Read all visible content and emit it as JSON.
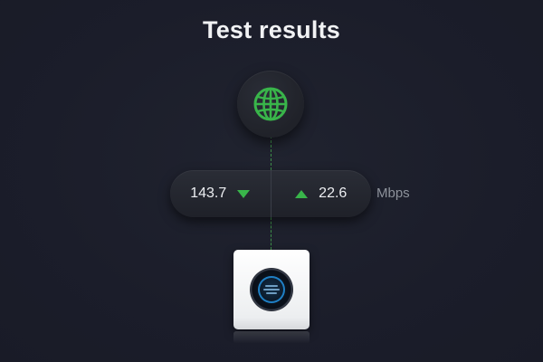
{
  "header": {
    "title": "Test results"
  },
  "speed_test": {
    "download": {
      "value": "143.7",
      "icon": "arrow-down-icon"
    },
    "upload": {
      "value": "22.6",
      "icon": "arrow-up-icon"
    },
    "unit": "Mbps"
  },
  "internet_node": {
    "icon": "globe-icon"
  },
  "device": {
    "icon": "router-icon"
  },
  "colors": {
    "background": "#1b1d2a",
    "accent_green": "#39b54a",
    "text_primary": "#eceef1",
    "text_muted": "#8d929b"
  }
}
